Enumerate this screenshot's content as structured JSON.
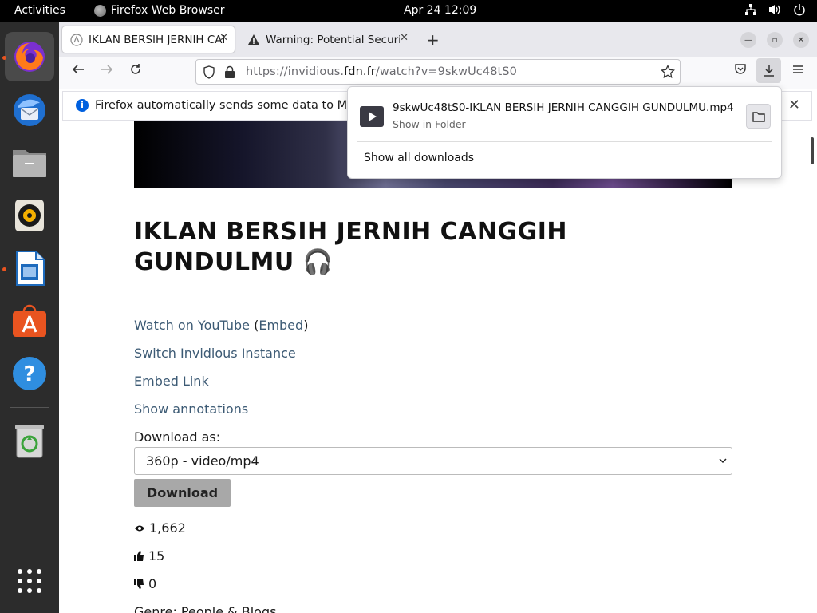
{
  "topbar": {
    "activities": "Activities",
    "app_name": "Firefox Web Browser",
    "clock": "Apr 24  12:09"
  },
  "dock": {
    "items": [
      {
        "name": "Firefox",
        "icon": "firefox-icon",
        "running": true,
        "active": true
      },
      {
        "name": "Thunderbird",
        "icon": "thunderbird-icon",
        "running": false
      },
      {
        "name": "Files",
        "icon": "files-icon",
        "running": false
      },
      {
        "name": "Rhythmbox",
        "icon": "rhythmbox-icon",
        "running": false
      },
      {
        "name": "LibreOffice Writer",
        "icon": "writer-icon",
        "running": true
      },
      {
        "name": "Ubuntu Software",
        "icon": "software-icon",
        "running": false
      },
      {
        "name": "Help",
        "icon": "help-icon",
        "running": false
      },
      {
        "name": "Trash",
        "icon": "trash-icon",
        "running": false
      },
      {
        "name": "Show Applications",
        "icon": "app-grid-icon",
        "running": false
      }
    ]
  },
  "tabs": [
    {
      "title": "IKLAN BERSIH JERNIH CANGGIH GUNDULMU",
      "active": true
    },
    {
      "title": "Warning: Potential Security Risk Ahead",
      "active": false
    }
  ],
  "navbar": {
    "url_prefix": "https://invidious.",
    "url_domain": "fdn.fr",
    "url_path": "/watch?v=9skwUc48tS0"
  },
  "notification": {
    "text": "Firefox automatically sends some data to Mozilla so that we can improve your experience."
  },
  "downloads_panel": {
    "file_name": "9skwUc48tS0-IKLAN BERSIH JERNIH CANGGIH GUNDULMU.mp4",
    "sub_label": "Show in Folder",
    "show_all": "Show all downloads"
  },
  "page": {
    "title": "IKLAN BERSIH JERNIH CANGGIH GUNDULMU",
    "title_emoji": "🎧",
    "watch_on_youtube": "Watch on YouTube",
    "embed_open": "(",
    "embed": "Embed",
    "embed_close": ")",
    "switch_instance": "Switch Invidious Instance",
    "embed_link": "Embed Link",
    "show_annotations": "Show annotations",
    "download_as": "Download as:",
    "quality_selected": "360p - video/mp4",
    "download_button": "Download",
    "views": "1,662",
    "likes": "15",
    "dislikes": "0",
    "genre": "Genre: People & Blogs"
  },
  "colors": {
    "accent": "#e95420",
    "link": "#3c5a74",
    "firefox_blue": "#0060df"
  }
}
